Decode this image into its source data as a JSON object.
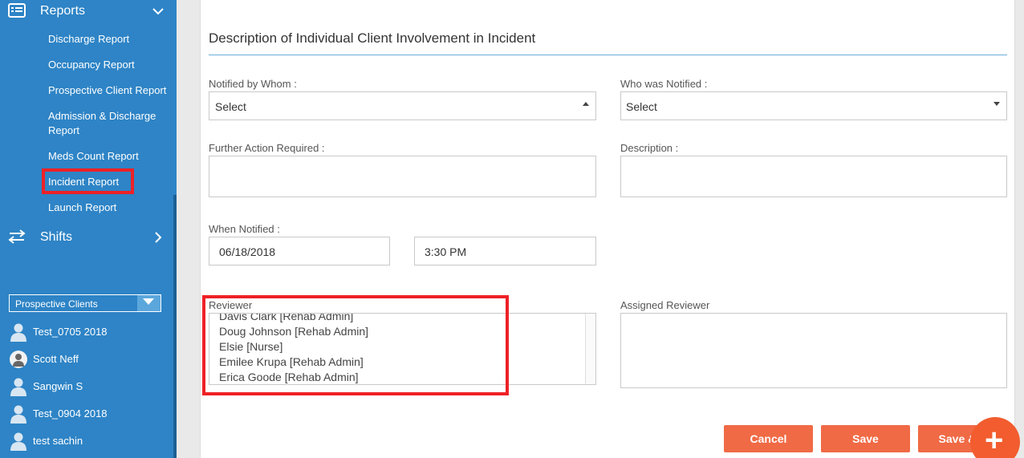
{
  "sidebar": {
    "reports": {
      "label": "Reports",
      "icon": "list-icon"
    },
    "report_items": [
      {
        "label": "Discharge Report"
      },
      {
        "label": "Occupancy Report"
      },
      {
        "label": "Prospective Client Report"
      },
      {
        "label": "Admission & Discharge"
      },
      {
        "label": "Report"
      },
      {
        "label": "Meds Count Report"
      },
      {
        "label": "Incident Report"
      },
      {
        "label": "Launch Report"
      }
    ],
    "shifts": {
      "label": "Shifts",
      "icon": "swap-arrows-icon"
    },
    "prospect_select": {
      "value": "Prospective Clients"
    },
    "clients": [
      {
        "name": "Test_0705 2018"
      },
      {
        "name": "Scott Neff"
      },
      {
        "name": "Sangwin S"
      },
      {
        "name": "Test_0904 2018"
      },
      {
        "name": "test sachin"
      }
    ]
  },
  "main": {
    "section_title": "Description of Individual Client Involvement in Incident",
    "notified_by": {
      "label": "Notified by Whom :",
      "value": "Select"
    },
    "who_notified": {
      "label": "Who was Notified :",
      "value": "Select"
    },
    "further_action": {
      "label": "Further Action Required :",
      "value": ""
    },
    "description": {
      "label": "Description :",
      "value": ""
    },
    "when_notified": {
      "label": "When Notified :",
      "date": "06/18/2018",
      "time": "3:30 PM"
    },
    "reviewer": {
      "label": "Reviewer",
      "options": [
        "Davis Clark [Rehab Admin]",
        "Doug Johnson [Rehab Admin]",
        "Elsie [Nurse]",
        "Emilee Krupa [Rehab Admin]",
        "Erica Goode [Rehab Admin]"
      ]
    },
    "assigned_reviewer": {
      "label": "Assigned Reviewer"
    },
    "buttons": {
      "cancel": "Cancel",
      "save": "Save",
      "save_send": "Save & S"
    },
    "fab": "+"
  },
  "colors": {
    "sidebar": "#2e84c6",
    "accent_button": "#f06a45",
    "highlight": "#ee2127"
  }
}
